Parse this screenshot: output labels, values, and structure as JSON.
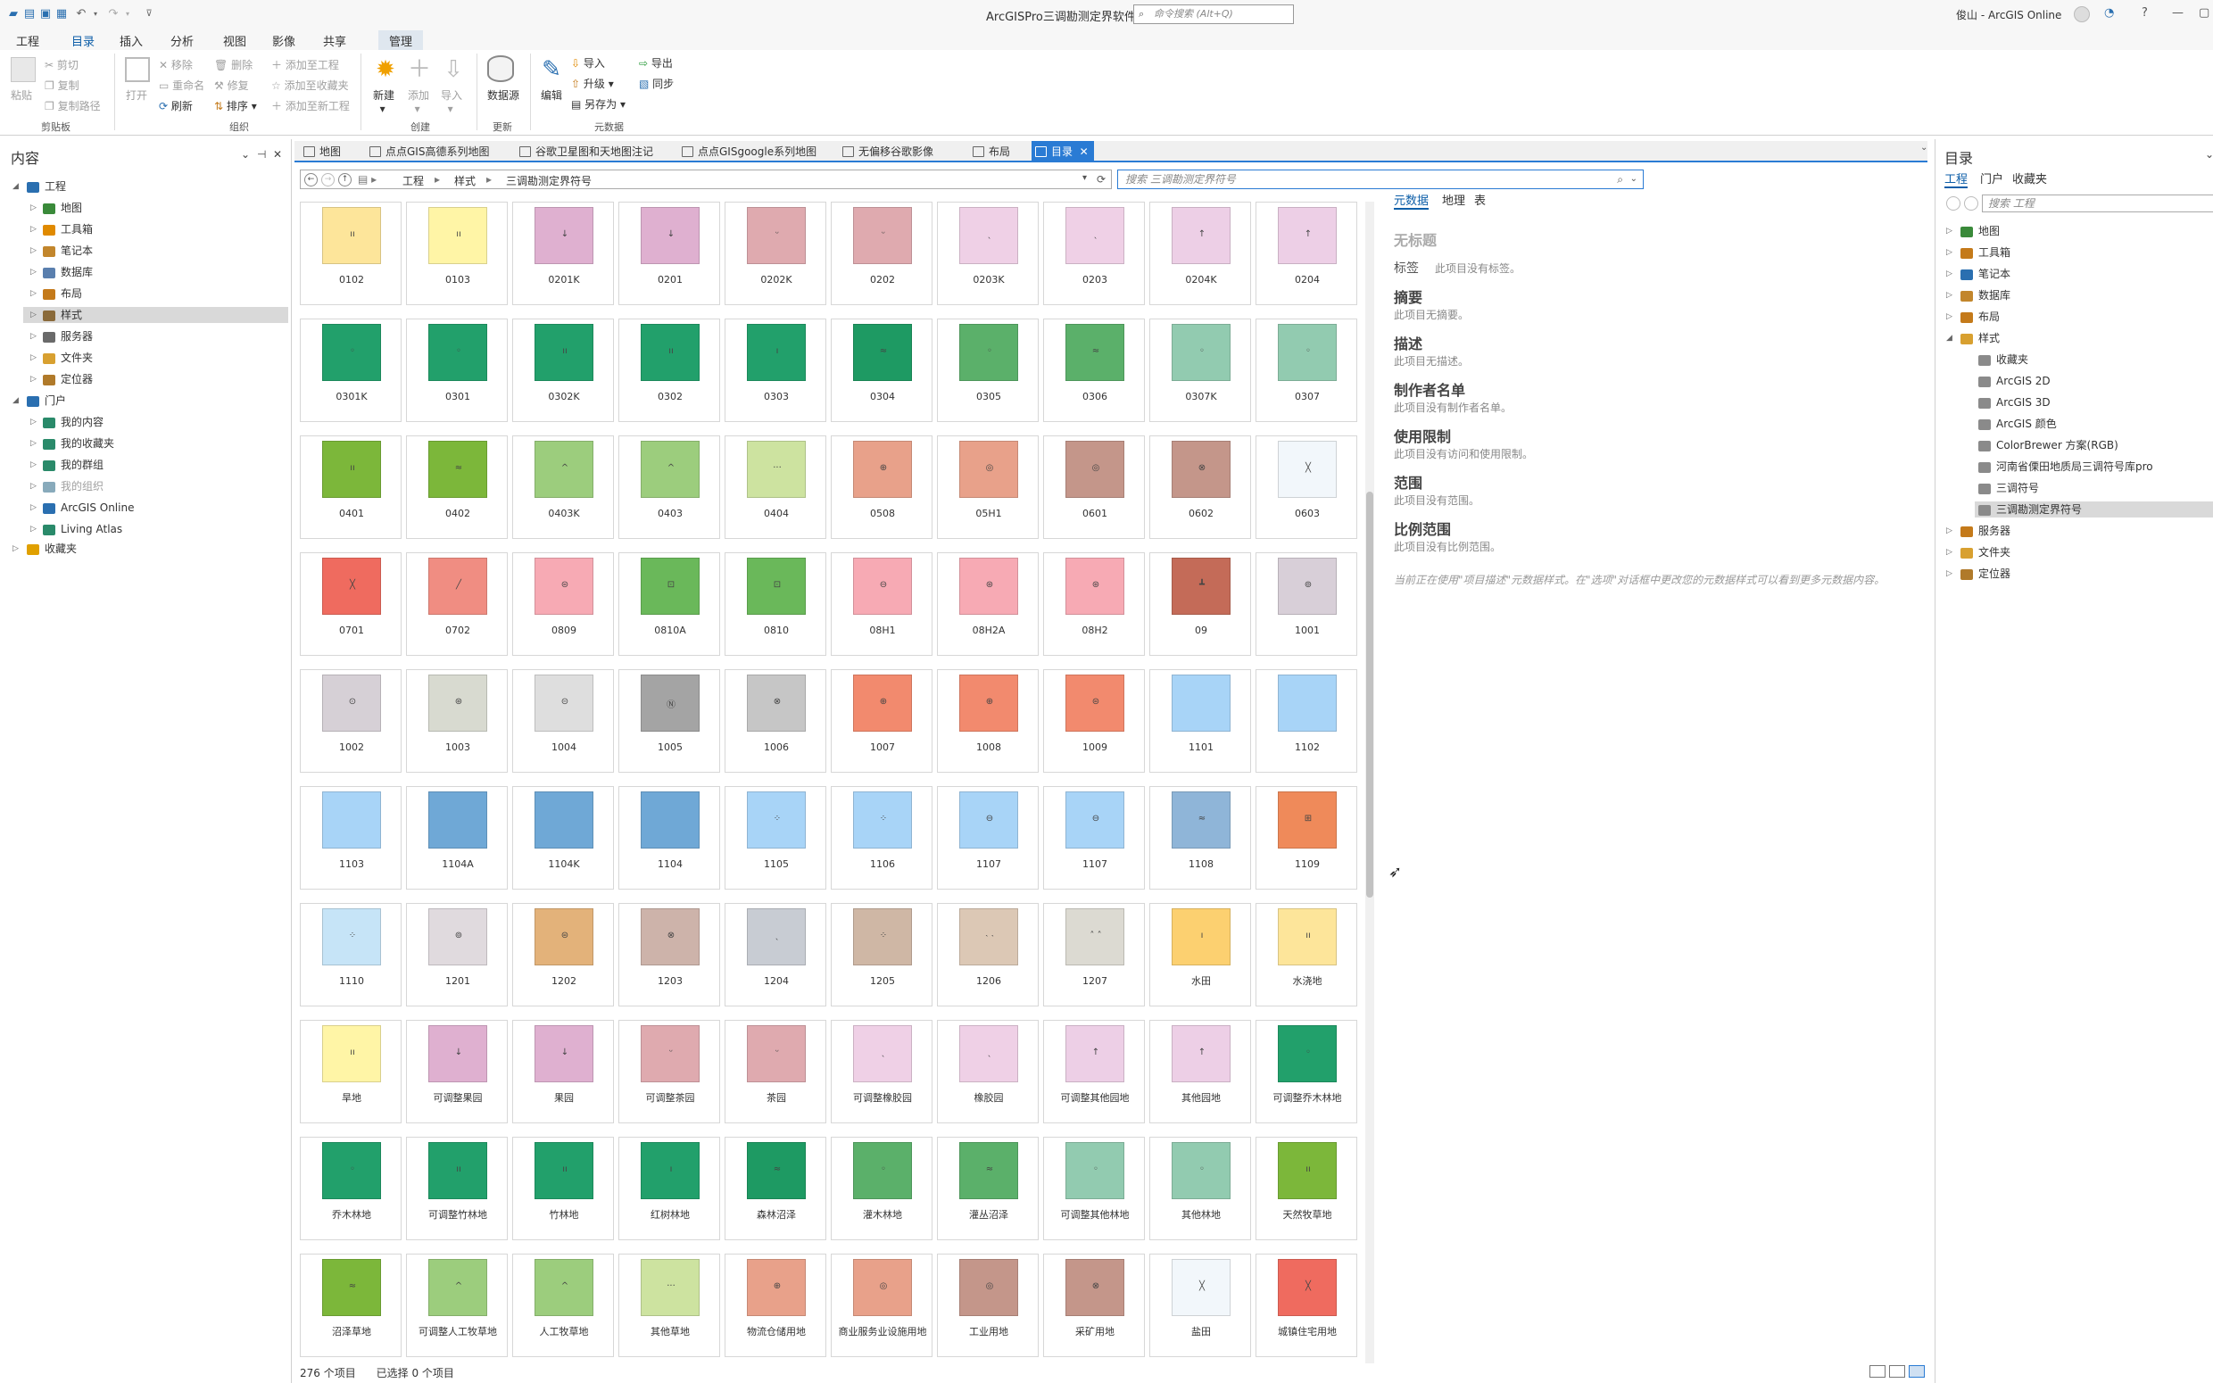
{
  "title_bar": {
    "app_title": "ArcGISPro三调勘测定界软件",
    "search_placeholder": "命令搜索 (Alt+Q)",
    "user": "俊山 - ArcGIS Online",
    "help": "?"
  },
  "ribbon_tabs": [
    {
      "label": "工程"
    },
    {
      "label": "目录"
    },
    {
      "label": "插入"
    },
    {
      "label": "分析"
    },
    {
      "label": "视图"
    },
    {
      "label": "影像"
    },
    {
      "label": "共享"
    },
    {
      "label": "管理"
    }
  ],
  "ribbon": {
    "paste": "粘贴",
    "cut": "剪切",
    "copy": "复制",
    "copy_path": "复制路径",
    "clipboard_group": "剪贴板",
    "open": "打开",
    "remove": "移除",
    "rename": "重命名",
    "refresh": "刷新",
    "delete": "删除",
    "repair": "修复",
    "sort": "排序",
    "add_to_project": "添加至工程",
    "add_to_favorites": "添加至收藏夹",
    "add_to_new_project": "添加至新工程",
    "organize_group": "组织",
    "new": "新建",
    "add": "添加",
    "import_big": "导入",
    "create_group": "创建",
    "datasource": "数据源",
    "update_group": "更新",
    "edit": "编辑",
    "import": "导入",
    "upgrade": "升级",
    "save_as": "另存为",
    "export": "导出",
    "sync": "同步",
    "metadata_group": "元数据"
  },
  "contents": {
    "title": "内容",
    "items": [
      {
        "label": "工程",
        "level": 0,
        "expanded": true
      },
      {
        "label": "地图",
        "level": 1
      },
      {
        "label": "工具箱",
        "level": 1
      },
      {
        "label": "笔记本",
        "level": 1
      },
      {
        "label": "数据库",
        "level": 1
      },
      {
        "label": "布局",
        "level": 1
      },
      {
        "label": "样式",
        "level": 1,
        "selected": true
      },
      {
        "label": "服务器",
        "level": 1
      },
      {
        "label": "文件夹",
        "level": 1
      },
      {
        "label": "定位器",
        "level": 1
      },
      {
        "label": "门户",
        "level": 0,
        "expanded": true
      },
      {
        "label": "我的内容",
        "level": 1
      },
      {
        "label": "我的收藏夹",
        "level": 1
      },
      {
        "label": "我的群组",
        "level": 1
      },
      {
        "label": "我的组织",
        "level": 1,
        "disabled": true
      },
      {
        "label": "ArcGIS Online",
        "level": 1
      },
      {
        "label": "Living Atlas",
        "level": 1
      },
      {
        "label": "收藏夹",
        "level": 0
      }
    ]
  },
  "view_tabs": [
    {
      "label": "地图"
    },
    {
      "label": "点点GIS高德系列地图"
    },
    {
      "label": "谷歌卫星图和天地图注记"
    },
    {
      "label": "点点GISgoogle系列地图"
    },
    {
      "label": "无偏移谷歌影像"
    },
    {
      "label": "布局"
    },
    {
      "label": "目录",
      "active": true
    }
  ],
  "address": {
    "crumbs": [
      "工程",
      "样式",
      "三调勘测定界符号"
    ],
    "search_placeholder": "搜索 三调勘测定界符号"
  },
  "grid_items": [
    {
      "label": "0102",
      "color": "#fde59a",
      "mark": "ıı"
    },
    {
      "label": "0103",
      "color": "#fff5a6",
      "mark": "ıı"
    },
    {
      "label": "0201K",
      "color": "#dfb0d0",
      "mark": "↓"
    },
    {
      "label": "0201",
      "color": "#dfb0d0",
      "mark": "↓"
    },
    {
      "label": "0202K",
      "color": "#dfaaaf",
      "mark": "ᵕ"
    },
    {
      "label": "0202",
      "color": "#dfaaaf",
      "mark": "ᵕ"
    },
    {
      "label": "0203K",
      "color": "#efd0e6",
      "mark": "ˎ"
    },
    {
      "label": "0203",
      "color": "#efd0e6",
      "mark": "ˎ"
    },
    {
      "label": "0204K",
      "color": "#edcfe6",
      "mark": "↑"
    },
    {
      "label": "0204",
      "color": "#edcfe6",
      "mark": "↑"
    },
    {
      "label": "0301K",
      "color": "#22a06b",
      "mark": "◦"
    },
    {
      "label": "0301",
      "color": "#22a06b",
      "mark": "◦"
    },
    {
      "label": "0302K",
      "color": "#22a06b",
      "mark": "ıı"
    },
    {
      "label": "0302",
      "color": "#22a06b",
      "mark": "ıı"
    },
    {
      "label": "0303",
      "color": "#22a06b",
      "mark": "ı"
    },
    {
      "label": "0304",
      "color": "#1e9a63",
      "mark": "≈"
    },
    {
      "label": "0305",
      "color": "#5bb06a",
      "mark": "◦"
    },
    {
      "label": "0306",
      "color": "#5bb06a",
      "mark": "≈"
    },
    {
      "label": "0307K",
      "color": "#92cbb0",
      "mark": "◦"
    },
    {
      "label": "0307",
      "color": "#92cbb0",
      "mark": "◦"
    },
    {
      "label": "0401",
      "color": "#7cb73a",
      "mark": "ıı"
    },
    {
      "label": "0402",
      "color": "#7cb73a",
      "mark": "≈"
    },
    {
      "label": "0403K",
      "color": "#9ccd7d",
      "mark": "^"
    },
    {
      "label": "0403",
      "color": "#9ccd7d",
      "mark": "^"
    },
    {
      "label": "0404",
      "color": "#cde3a0",
      "mark": "···"
    },
    {
      "label": "0508",
      "color": "#e8a18a",
      "mark": "⊕"
    },
    {
      "label": "05H1",
      "color": "#e8a18a",
      "mark": "◎"
    },
    {
      "label": "0601",
      "color": "#c4968a",
      "mark": "◎"
    },
    {
      "label": "0602",
      "color": "#c4968a",
      "mark": "⊗"
    },
    {
      "label": "0603",
      "color": "#f2f7fb",
      "mark": "╳"
    },
    {
      "label": "0701",
      "color": "#ef6b5f",
      "mark": "╳"
    },
    {
      "label": "0702",
      "color": "#f08d82",
      "mark": "╱"
    },
    {
      "label": "0809",
      "color": "#f7aab4",
      "mark": "⊜"
    },
    {
      "label": "0810A",
      "color": "#6ab85a",
      "mark": "⊡"
    },
    {
      "label": "0810",
      "color": "#6ab85a",
      "mark": "⊡"
    },
    {
      "label": "08H1",
      "color": "#f7aab4",
      "mark": "⊖"
    },
    {
      "label": "08H2A",
      "color": "#f7aab4",
      "mark": "⊛"
    },
    {
      "label": "08H2",
      "color": "#f7aab4",
      "mark": "⊛"
    },
    {
      "label": "09",
      "color": "#c46b58",
      "mark": "┻"
    },
    {
      "label": "1001",
      "color": "#d8cfd8",
      "mark": "⊚"
    },
    {
      "label": "1002",
      "color": "#d6d0d6",
      "mark": "⊙"
    },
    {
      "label": "1003",
      "color": "#d8dad0",
      "mark": "⊛"
    },
    {
      "label": "1004",
      "color": "#dedede",
      "mark": "⊝"
    },
    {
      "label": "1005",
      "color": "#a4a4a4",
      "mark": "Ⓝ"
    },
    {
      "label": "1006",
      "color": "#c6c6c6",
      "mark": "⊗"
    },
    {
      "label": "1007",
      "color": "#f28a6e",
      "mark": "⊕"
    },
    {
      "label": "1008",
      "color": "#f28a6e",
      "mark": "⊕"
    },
    {
      "label": "1009",
      "color": "#f28a6e",
      "mark": "⊜"
    },
    {
      "label": "1101",
      "color": "#a8d4f7",
      "mark": ""
    },
    {
      "label": "1102",
      "color": "#a8d4f7",
      "mark": ""
    },
    {
      "label": "1103",
      "color": "#a8d4f7",
      "mark": ""
    },
    {
      "label": "1104A",
      "color": "#6fa8d6",
      "mark": ""
    },
    {
      "label": "1104K",
      "color": "#6fa8d6",
      "mark": ""
    },
    {
      "label": "1104",
      "color": "#6fa8d6",
      "mark": ""
    },
    {
      "label": "1105",
      "color": "#a8d4f7",
      "mark": "⁘"
    },
    {
      "label": "1106",
      "color": "#a8d4f7",
      "mark": "⁘"
    },
    {
      "label": "1107",
      "color": "#a8d4f7",
      "mark": "⊖"
    },
    {
      "label": "1107",
      "color": "#a8d4f7",
      "mark": "⊖"
    },
    {
      "label": "1108",
      "color": "#8fb5d8",
      "mark": "≈"
    },
    {
      "label": "1109",
      "color": "#ef8a5a",
      "mark": "⊞"
    },
    {
      "label": "1110",
      "color": "#c6e4f7",
      "mark": "⁘"
    },
    {
      "label": "1201",
      "color": "#e0dade",
      "mark": "⊚"
    },
    {
      "label": "1202",
      "color": "#e3b27a",
      "mark": "⊜"
    },
    {
      "label": "1203",
      "color": "#cdb3aa",
      "mark": "⊗"
    },
    {
      "label": "1204",
      "color": "#c8ccd3",
      "mark": "ˎ"
    },
    {
      "label": "1205",
      "color": "#cfb7a5",
      "mark": "⁘"
    },
    {
      "label": "1206",
      "color": "#dcc8b5",
      "mark": "˴ ˴"
    },
    {
      "label": "1207",
      "color": "#dcdad2",
      "mark": "˄ ˄"
    },
    {
      "label": "水田",
      "color": "#fcd070",
      "mark": "ı"
    },
    {
      "label": "水浇地",
      "color": "#fde59a",
      "mark": "ıı"
    },
    {
      "label": "旱地",
      "color": "#fff5a6",
      "mark": "ıı"
    },
    {
      "label": "可调整果园",
      "color": "#dfb0d0",
      "mark": "↓"
    },
    {
      "label": "果园",
      "color": "#dfb0d0",
      "mark": "↓"
    },
    {
      "label": "可调整茶园",
      "color": "#dfaaaf",
      "mark": "ᵕ"
    },
    {
      "label": "茶园",
      "color": "#dfaaaf",
      "mark": "ᵕ"
    },
    {
      "label": "可调整橡胶园",
      "color": "#efd0e6",
      "mark": "ˎ"
    },
    {
      "label": "橡胶园",
      "color": "#efd0e6",
      "mark": "ˎ"
    },
    {
      "label": "可调整其他园地",
      "color": "#edcfe6",
      "mark": "↑"
    },
    {
      "label": "其他园地",
      "color": "#edcfe6",
      "mark": "↑"
    },
    {
      "label": "可调整乔木林地",
      "color": "#22a06b",
      "mark": "◦"
    },
    {
      "label": "乔木林地",
      "color": "#22a06b",
      "mark": "◦"
    },
    {
      "label": "可调整竹林地",
      "color": "#22a06b",
      "mark": "ıı"
    },
    {
      "label": "竹林地",
      "color": "#22a06b",
      "mark": "ıı"
    },
    {
      "label": "红树林地",
      "color": "#22a06b",
      "mark": "ı"
    },
    {
      "label": "森林沼泽",
      "color": "#1e9a63",
      "mark": "≈"
    },
    {
      "label": "灌木林地",
      "color": "#5bb06a",
      "mark": "◦"
    },
    {
      "label": "灌丛沼泽",
      "color": "#5bb06a",
      "mark": "≈"
    },
    {
      "label": "可调整其他林地",
      "color": "#92cbb0",
      "mark": "◦"
    },
    {
      "label": "其他林地",
      "color": "#92cbb0",
      "mark": "◦"
    },
    {
      "label": "天然牧草地",
      "color": "#7cb73a",
      "mark": "ıı"
    },
    {
      "label": "沼泽草地",
      "color": "#7cb73a",
      "mark": "≈"
    },
    {
      "label": "可调整人工牧草地",
      "color": "#9ccd7d",
      "mark": "^"
    },
    {
      "label": "人工牧草地",
      "color": "#9ccd7d",
      "mark": "^"
    },
    {
      "label": "其他草地",
      "color": "#cde3a0",
      "mark": "···"
    },
    {
      "label": "物流仓储用地",
      "color": "#e8a18a",
      "mark": "⊕"
    },
    {
      "label": "商业服务业设施用地",
      "color": "#e8a18a",
      "mark": "◎"
    },
    {
      "label": "工业用地",
      "color": "#c4968a",
      "mark": "◎"
    },
    {
      "label": "采矿用地",
      "color": "#c4968a",
      "mark": "⊗"
    },
    {
      "label": "盐田",
      "color": "#f2f7fb",
      "mark": "╳"
    },
    {
      "label": "城镇住宅用地",
      "color": "#ef6b5f",
      "mark": "╳"
    }
  ],
  "status": {
    "count": "276 个项目",
    "selected": "已选择 0 个项目"
  },
  "metadata": {
    "tabs": [
      "元数据",
      "地理",
      "表"
    ],
    "heading_untitled": "无标题",
    "tags_label": "标签",
    "tags_text": "此项目没有标签。",
    "summary_h": "摘要",
    "summary_text": "此项目无摘要。",
    "desc_h": "描述",
    "desc_text": "此项目无描述。",
    "credits_h": "制作者名单",
    "credits_text": "此项目没有制作者名单。",
    "limits_h": "使用限制",
    "limits_text": "此项目没有访问和使用限制。",
    "extent_h": "范围",
    "extent_text": "此项目没有范围。",
    "scale_h": "比例范围",
    "scale_text": "此项目没有比例范围。",
    "note": "当前正在使用\"项目描述\"元数据样式。在\"选项\"对话框中更改您的元数据样式可以看到更多元数据内容。"
  },
  "catalog": {
    "title": "目录",
    "tabs": [
      "工程",
      "门户",
      "收藏夹"
    ],
    "search_placeholder": "搜索 工程",
    "items": [
      {
        "label": "地图",
        "level": 0
      },
      {
        "label": "工具箱",
        "level": 0
      },
      {
        "label": "笔记本",
        "level": 0
      },
      {
        "label": "数据库",
        "level": 0
      },
      {
        "label": "布局",
        "level": 0
      },
      {
        "label": "样式",
        "level": 0,
        "expanded": true
      },
      {
        "label": "收藏夹",
        "level": 1
      },
      {
        "label": "ArcGIS 2D",
        "level": 1
      },
      {
        "label": "ArcGIS 3D",
        "level": 1
      },
      {
        "label": "ArcGIS 颜色",
        "level": 1
      },
      {
        "label": "ColorBrewer 方案(RGB)",
        "level": 1
      },
      {
        "label": "河南省傈田地质局三调符号库pro",
        "level": 1
      },
      {
        "label": "三调符号",
        "level": 1
      },
      {
        "label": "三调勘测定界符号",
        "level": 1,
        "selected": true
      },
      {
        "label": "服务器",
        "level": 0
      },
      {
        "label": "文件夹",
        "level": 0
      },
      {
        "label": "定位器",
        "level": 0
      }
    ]
  }
}
